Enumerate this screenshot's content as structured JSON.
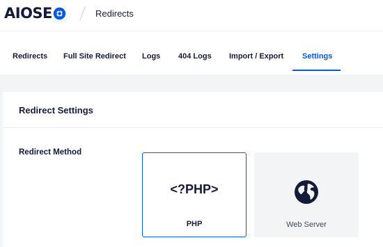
{
  "header": {
    "logo_text": "AIOSE",
    "logo_icon": "gear-o-icon",
    "breadcrumb": "Redirects"
  },
  "tabs": [
    {
      "label": "Redirects",
      "active": false
    },
    {
      "label": "Full Site Redirect",
      "active": false
    },
    {
      "label": "Logs",
      "active": false
    },
    {
      "label": "404 Logs",
      "active": false
    },
    {
      "label": "Import / Export",
      "active": false
    },
    {
      "label": "Settings",
      "active": true
    }
  ],
  "panel": {
    "title": "Redirect Settings",
    "redirect_method": {
      "label": "Redirect Method",
      "options": [
        {
          "mark": "<?PHP>",
          "label": "PHP",
          "selected": true,
          "icon": "php-code-icon"
        },
        {
          "label": "Web Server",
          "selected": false,
          "icon": "globe-icon"
        }
      ]
    }
  },
  "colors": {
    "accent": "#005ae0",
    "text": "#141b38",
    "page_bg": "#f3f4f5"
  }
}
